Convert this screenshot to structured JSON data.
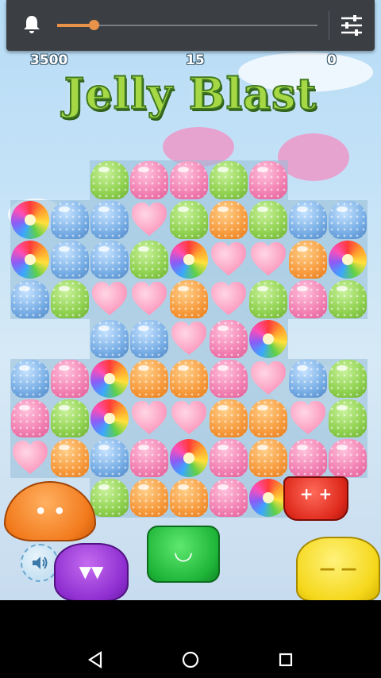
{
  "status_panel": {
    "volume_level": 0.14,
    "bell_icon": "bell-icon",
    "settings_icon": "tune-icon"
  },
  "hud": {
    "score": "3500",
    "moves": "15",
    "target": "0"
  },
  "title": "Jelly Blast",
  "board": {
    "rows": [
      [
        "",
        "",
        "green",
        "pink",
        "pink",
        "green",
        "pink",
        "",
        ""
      ],
      [
        "rainbow",
        "blue",
        "blue",
        "heart",
        "green",
        "orange",
        "green",
        "blue",
        "blue"
      ],
      [
        "rainbow",
        "blue",
        "blue",
        "green",
        "rainbow",
        "heart",
        "heart",
        "orange",
        "rainbow"
      ],
      [
        "blue",
        "green",
        "heart",
        "heart",
        "orange",
        "heart",
        "green",
        "pink",
        "green"
      ],
      [
        "",
        "",
        "blue",
        "blue",
        "heart",
        "pink",
        "rainbow",
        "",
        ""
      ],
      [
        "blue",
        "pink",
        "rainbow",
        "orange",
        "orange",
        "pink",
        "heart",
        "blue",
        "green"
      ],
      [
        "pink",
        "green",
        "rainbow",
        "heart",
        "heart",
        "orange",
        "orange",
        "heart",
        "green"
      ],
      [
        "heart",
        "orange",
        "blue",
        "pink",
        "rainbow",
        "pink",
        "orange",
        "pink",
        "pink"
      ],
      [
        "",
        "",
        "green",
        "orange",
        "orange",
        "pink",
        "rainbow",
        "",
        ""
      ]
    ]
  },
  "jellies": {
    "orange_face": "• •",
    "green_face": "◡",
    "purple_face": "▼▼",
    "yellow_face": "— —",
    "red_face": "+ +"
  },
  "sound_button_icon": "speaker-icon",
  "nav": {
    "back_icon": "back-triangle-icon",
    "home_icon": "home-circle-icon",
    "recents_icon": "recents-square-icon"
  }
}
